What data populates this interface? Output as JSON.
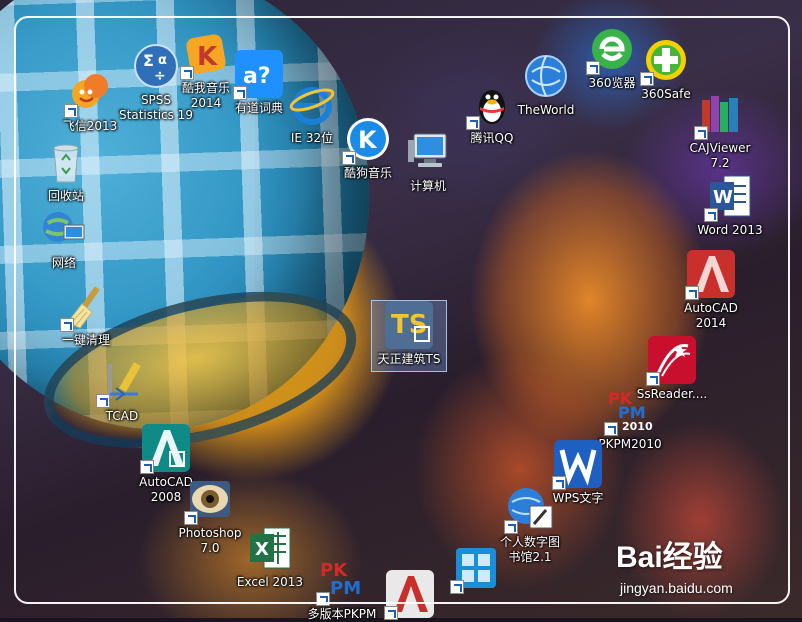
{
  "icons": [
    {
      "name": "feixin-2013",
      "label": "飞信2013"
    },
    {
      "name": "spss-statistics-19",
      "label": "SPSS\nStatistics 19"
    },
    {
      "name": "kuwo-music-2014",
      "label": "酷我音乐\n2014"
    },
    {
      "name": "youdao-dictionary",
      "label": "有道词典"
    },
    {
      "name": "ie-32",
      "label": "IE 32位"
    },
    {
      "name": "kugou-music",
      "label": "酷狗音乐"
    },
    {
      "name": "computer",
      "label": "计算机"
    },
    {
      "name": "tencent-qq",
      "label": "腾讯QQ"
    },
    {
      "name": "theworld",
      "label": "TheWorld"
    },
    {
      "name": "360-browser",
      "label": "360览器"
    },
    {
      "name": "360safe",
      "label": "360Safe"
    },
    {
      "name": "cajviewer",
      "label": "CAJViewer\n7.2"
    },
    {
      "name": "word-2013",
      "label": "Word 2013"
    },
    {
      "name": "recycle-bin",
      "label": "回收站"
    },
    {
      "name": "network",
      "label": "网络"
    },
    {
      "name": "one-click-clean",
      "label": "一键清理"
    },
    {
      "name": "tcad",
      "label": "TCAD"
    },
    {
      "name": "autocad-2008",
      "label": "AutoCAD\n2008"
    },
    {
      "name": "photoshop-7",
      "label": "Photoshop\n7.0"
    },
    {
      "name": "excel-2013",
      "label": "Excel 2013"
    },
    {
      "name": "tarch",
      "label": "天正建筑TS"
    },
    {
      "name": "autocad-2014",
      "label": "AutoCAD\n2014"
    },
    {
      "name": "ssreader",
      "label": "SsReader...."
    },
    {
      "name": "pkpm2010",
      "label": "PKPM2010"
    },
    {
      "name": "wps",
      "label": "WPS文字"
    },
    {
      "name": "digital-library",
      "label": "个人数字图\n书馆2.1"
    },
    {
      "name": "pkpm-multi",
      "label": "多版本PKPM"
    }
  ],
  "watermark": {
    "logo": "Bai经验",
    "url": "jingyan.baidu.com"
  }
}
